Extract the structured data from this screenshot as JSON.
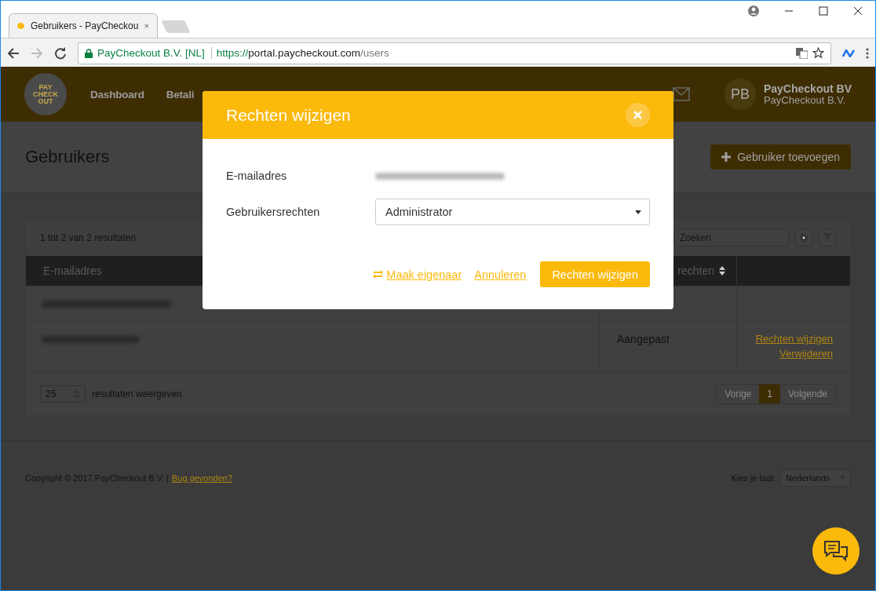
{
  "browser": {
    "tabs": [
      {
        "title": "Gebruikers - PayCheckou",
        "selected": true
      }
    ],
    "forward_disabled": true,
    "site_identity": "PayCheckout B.V. [NL]",
    "url": {
      "scheme": "https://",
      "host": "portal.paycheckout.com",
      "path": "/users"
    }
  },
  "header": {
    "logo": "PAY CHECK OUT",
    "nav": [
      {
        "label": "Dashboard"
      },
      {
        "label": "Betali"
      }
    ],
    "avatar": "PB",
    "company": "PayCheckout BV",
    "company_legal": "PayCheckout B.V."
  },
  "page": {
    "title": "Gebruikers",
    "add_button": "Gebruiker toevoegen"
  },
  "table": {
    "summary": "1 tot 2 van 2 resultaten",
    "search_placeholder": "Zoeken",
    "columns": [
      "E-mailadres",
      "rechten"
    ],
    "rows": [
      {
        "kind": "email_only"
      },
      {
        "kind": "full",
        "rights": "Aangepast",
        "actions": [
          "Rechten wijzigen",
          "Verwijderen"
        ]
      }
    ],
    "page_size": "25",
    "page_size_label": "resultaten weergeven",
    "pagination": {
      "prev": "Vorige",
      "pages": [
        {
          "label": "1",
          "selected": true
        }
      ],
      "next": "Volgende"
    }
  },
  "footer": {
    "copyright": "Copyright © 2017 PayCheckout B.V. |",
    "bug_link": "Bug gevonden?",
    "language_label": "Kies je taal:",
    "language": "Nederlands"
  },
  "modal": {
    "title": "Rechten wijzigen",
    "fields": [
      {
        "label": "E-mailadres",
        "kind": "blurred"
      },
      {
        "label": "Gebruikersrechten",
        "kind": "select",
        "value": "Administrator"
      }
    ],
    "owner_link": "Maak eigenaar",
    "cancel": "Annuleren",
    "submit": "Rechten wijzigen"
  }
}
